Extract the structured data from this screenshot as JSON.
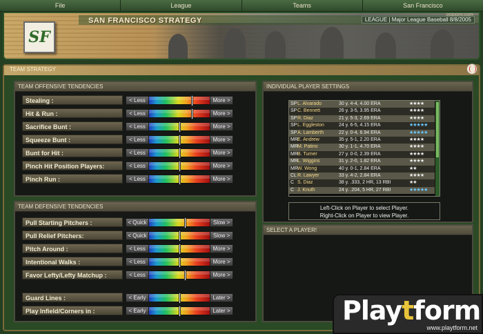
{
  "menu": [
    "File",
    "League",
    "Teams",
    "San Francisco"
  ],
  "banner": {
    "title": "SAN FRANCISCO STRATEGY",
    "logo_text": "SF",
    "league_info": "LEAGUE | Major League Baseball 8/8/2005",
    "website": "ootpdev.com"
  },
  "strategy": {
    "header": "TEAM STRATEGY"
  },
  "offense": {
    "title": "TEAM OFFENSIVE TENDENCIES",
    "rows": [
      {
        "label": "Stealing :",
        "left": "< Less",
        "right": "More >",
        "level": 0.72
      },
      {
        "label": "Hit & Run :",
        "left": "< Less",
        "right": "More >",
        "level": 0.72
      },
      {
        "label": "Sacrifice Bunt :",
        "left": "< Less",
        "right": "More >",
        "level": 0.5
      },
      {
        "label": "Squeeze Bunt :",
        "left": "< Less",
        "right": "More >",
        "level": 0.5
      },
      {
        "label": "Bunt for Hit :",
        "left": "< Less",
        "right": "More >",
        "level": 0.5
      },
      {
        "label": "Pinch Hit Position Players:",
        "left": "< Less",
        "right": "More >",
        "level": 0.5
      },
      {
        "label": "Pinch Run :",
        "left": "< Less",
        "right": "More >",
        "level": 0.5
      }
    ]
  },
  "defense": {
    "title": "TEAM DEFENSIVE TENDENCIES",
    "rows": [
      {
        "label": "Pull Starting Pitchers :",
        "left": "< Quick",
        "right": "Slow >",
        "level": 0.6
      },
      {
        "label": "Pull Relief Pitchers:",
        "left": "< Quick",
        "right": "Slow >",
        "level": 0.5
      },
      {
        "label": "Pitch Around :",
        "left": "< Less",
        "right": "More >",
        "level": 0.5
      },
      {
        "label": "Intentional Walks :",
        "left": "< Less",
        "right": "More >",
        "level": 0.5
      },
      {
        "label": "Favor Lefty/Lefty Matchup :",
        "left": "< Less",
        "right": "More >",
        "level": 0.6
      },
      {
        "label": "Guard Lines :",
        "left": "< Early",
        "right": "Later >",
        "level": 0.5
      },
      {
        "label": "Play Infield/Corners in :",
        "left": "< Early",
        "right": "Later >",
        "level": 0.5
      }
    ]
  },
  "players_panel": {
    "title": "INDIVIDUAL PLAYER SETTINGS",
    "players": [
      {
        "pos": "SP",
        "name": "L. Alvarado",
        "stats": "30 y.  4-4, 4.00 ERA",
        "stars": "★★★★",
        "color": "#f0f0f0"
      },
      {
        "pos": "SP",
        "name": "C. Bennett",
        "stats": "26 y.  3-5, 3.95 ERA",
        "stars": "★★★★",
        "color": "#f0f0f0"
      },
      {
        "pos": "SP",
        "name": "R. Diaz",
        "stats": "21 y.  5-3, 2.69 ERA",
        "stars": "★★★★",
        "color": "#f0f0f0"
      },
      {
        "pos": "SP",
        "name": "L. Eggleston",
        "stats": "24 y.  6-5, 4.15 ERA",
        "stars": "★★★★★",
        "color": "#6ec8ff"
      },
      {
        "pos": "SP",
        "name": "A. Lamberth",
        "stats": "22 y.  0-4, 6.94 ERA",
        "stars": "★★★★★",
        "color": "#6ec8ff"
      },
      {
        "pos": "MR",
        "name": "E. Andrew",
        "stats": "35 y.  5-1, 2.20 ERA",
        "stars": "★★★★",
        "color": "#f0f0f0"
      },
      {
        "pos": "MR",
        "name": "M. Patino",
        "stats": "30 y.  1-1, 4.70 ERA",
        "stars": "★★★★",
        "color": "#f0f0f0"
      },
      {
        "pos": "MR",
        "name": "B. Turner",
        "stats": "27 y.  0-0, 2.39 ERA",
        "stars": "★★★★",
        "color": "#f0f0f0"
      },
      {
        "pos": "MR",
        "name": "L. Wiggins",
        "stats": "31 y.  2-0, 1.82 ERA",
        "stars": "★★★★",
        "color": "#f0f0f0"
      },
      {
        "pos": "MR",
        "name": "W. Wong",
        "stats": "40 y.  0-1, 2.84 ERA",
        "stars": "★★",
        "color": "#f0f0f0"
      },
      {
        "pos": "CL",
        "name": "R. Lawyer",
        "stats": "33 y.  4-2, 2.84 ERA",
        "stars": "★★★★",
        "color": "#f0f0f0"
      },
      {
        "pos": "C",
        "name": "S. Diaz",
        "stats": "38 y.  .333, 2 HR, 13 RBI",
        "stars": "★★",
        "color": "#f0f0f0"
      },
      {
        "pos": "C",
        "name": "J. Knuth",
        "stats": "24 y.  .204, 5 HR, 27 RBI",
        "stars": "★★★★★",
        "color": "#6ec8ff"
      }
    ],
    "hint1": "Left-Click on Player to select Player.",
    "hint2": "Right-Click on Player to view Player."
  },
  "select_panel": {
    "title": "SELECT A PLAYER!"
  },
  "watermark": {
    "main_a": "Play",
    "main_b": "t",
    "main_c": "form",
    "sub": "www.playtform.net"
  }
}
